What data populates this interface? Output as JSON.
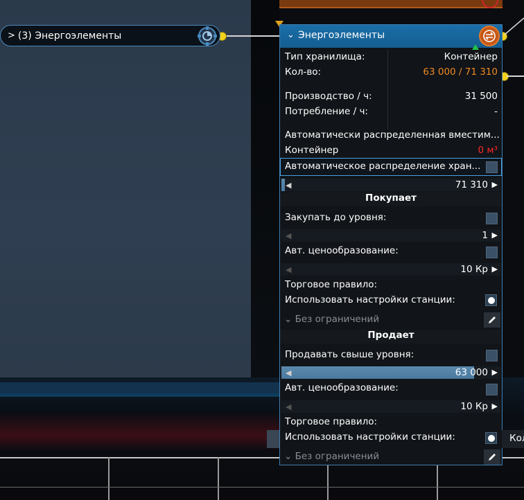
{
  "left_node": {
    "label": "(3) Энергоэлементы"
  },
  "panel": {
    "title": "Энергоэлементы",
    "storage_type_label": "Тип хранилища:",
    "storage_type_value": "Контейнер",
    "amount_label": "Кол-во:",
    "amount_value": "63 000 / 71 310",
    "production_label": "Производство / ч:",
    "production_value": "31 500",
    "consumption_label": "Потребление / ч:",
    "consumption_value": "-",
    "auto_capacity_label": "Автоматически распределенная вместим...",
    "container_label": "Контейнер",
    "container_value": "0 м³",
    "auto_dist_label": "Автоматическое распределение хран...",
    "storage_slider_value": "71 310",
    "buys": {
      "section_title": "Покупает",
      "buy_to_level_label": "Закупать до уровня:",
      "buy_slider_value": "1",
      "auto_price_label": "Авт. ценообразование:",
      "price_value": "10 Кр",
      "trade_rule_label": "Торговое правило:",
      "use_station_label": "Использовать настройки станции:",
      "no_limits_label": "Без ограничений"
    },
    "sells": {
      "section_title": "Продает",
      "sell_above_label": "Продавать свыше уровня:",
      "sell_slider_value": "63 000",
      "sell_slider_fill": 0.88,
      "auto_price_label": "Авт. ценообразование:",
      "price_value": "10 Кр",
      "trade_rule_label": "Торговое правило:",
      "use_station_label": "Использовать настройки станции:",
      "no_limits_label": "Без ограничений"
    }
  },
  "right_fragment": {
    "text": "Кол"
  },
  "colors": {
    "accent": "#1a6fa8",
    "orange": "#f08a24",
    "red": "#ff2a2a",
    "connector": "#f4d21b"
  }
}
